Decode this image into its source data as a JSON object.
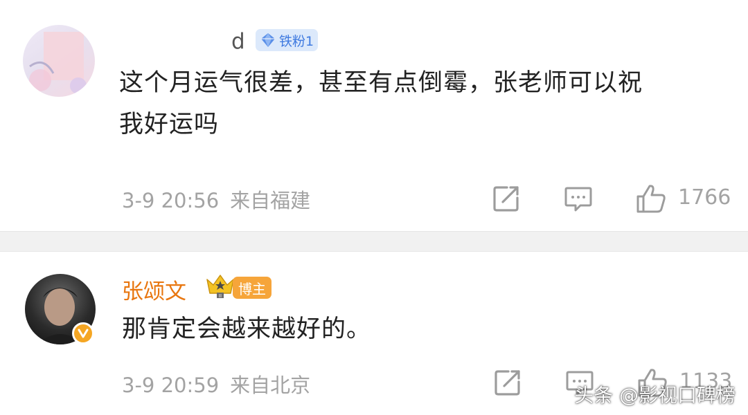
{
  "comments": [
    {
      "username_visible": "d",
      "badge_label": "铁粉1",
      "text_line1": "这个月运气很差，甚至有点倒霉，张老师可以祝",
      "text_line2": "我好运吗",
      "time": "3-9 20:56",
      "location": "来自福建",
      "likes": "1766",
      "icons": [
        "share-icon",
        "comment-icon",
        "like-icon"
      ]
    },
    {
      "username": "张颂文",
      "badge_label": "博主",
      "text": "那肯定会越来越好的。",
      "time": "3-9 20:59",
      "location": "来自北京",
      "likes": "1133",
      "icons": [
        "share-icon",
        "comment-icon",
        "like-icon"
      ]
    }
  ],
  "watermark": "头条 @影视口碑榜",
  "colors": {
    "author_name": "#e8760f",
    "fan_badge_bg": "#dce9fb",
    "fan_badge_text": "#3f7ae0",
    "host_badge_bg": "#f6a53a",
    "meta_gray": "#a3a3a3",
    "divider": "#f1f1f1"
  }
}
